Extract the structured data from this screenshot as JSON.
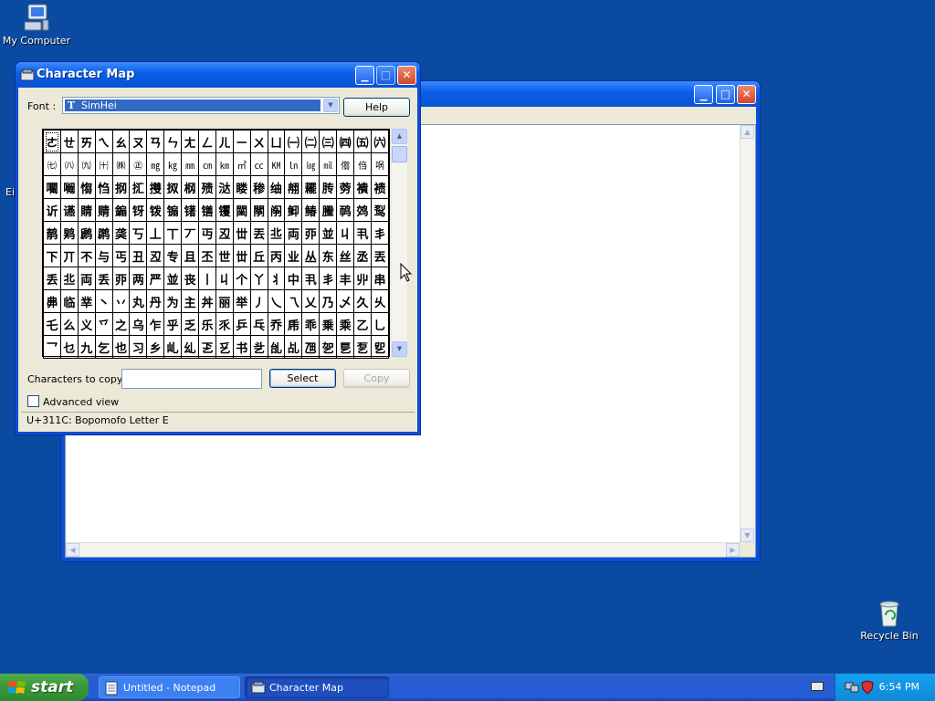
{
  "desktop": {
    "icons": [
      {
        "label": "My Computer"
      },
      {
        "label": "Recycle Bin"
      }
    ],
    "partial_label": "Ei"
  },
  "charmap": {
    "title": "Character Map",
    "font_label": "Font :",
    "font_value": "SimHei",
    "help_label": "Help",
    "copy_label": "Characters to copy :",
    "copy_value": "",
    "select_label": "Select",
    "copy_button_label": "Copy",
    "advanced_label": "Advanced view",
    "status": "U+311C: Bopomofo Letter E",
    "grid": [
      [
        "ㄜ",
        "ㄝ",
        "ㄞ",
        "ㄟ",
        "ㄠ",
        "ㄡ",
        "ㄢ",
        "ㄣ",
        "ㄤ",
        "ㄥ",
        "ㄦ",
        "ㄧ",
        "ㄨ",
        "ㄩ",
        "㈠",
        "㈡",
        "㈢",
        "㈣",
        "㈤",
        "㈥"
      ],
      [
        "㈦",
        "㈧",
        "㈨",
        "㈩",
        "㈱",
        "㊣",
        "㎎",
        "㎏",
        "㎜",
        "㎝",
        "㎞",
        "㎡",
        "㏄",
        "㏎",
        "㏑",
        "㏒",
        "㏕",
        "㑳",
        "㑇",
        "㖞"
      ],
      [
        "㘚",
        "㘎",
        "㥮",
        "㤘",
        "㧏",
        "㧟",
        "㩳",
        "㧐",
        "㭎",
        "㱮",
        "㳠",
        "䁖",
        "䅟",
        "䌷",
        "䎃",
        "䎱",
        "䏝",
        "䓖",
        "䙡",
        "䙌"
      ],
      [
        "䜣",
        "䜩",
        "䝼",
        "䞍",
        "䥇",
        "䥺",
        "䥽",
        "䦂",
        "䦃",
        "䦅",
        "䦆",
        "䦟",
        "䦛",
        "䦶",
        "䲟",
        "䲠",
        "䲢",
        "䴓",
        "䴔",
        "䴕"
      ],
      [
        "䴖",
        "䴗",
        "䴘",
        "䴙",
        "䶮",
        "丂",
        "丄",
        "丅",
        "丆",
        "丏",
        "丒",
        "丗",
        "丟",
        "丠",
        "両",
        "丣",
        "並",
        "丩",
        "丮",
        "丯"
      ],
      [
        "下",
        "丌",
        "不",
        "与",
        "丐",
        "丑",
        "丒",
        "专",
        "且",
        "丕",
        "世",
        "丗",
        "丘",
        "丙",
        "业",
        "丛",
        "东",
        "丝",
        "丞",
        "丟"
      ],
      [
        "丢",
        "丠",
        "両",
        "丢",
        "丣",
        "两",
        "严",
        "並",
        "丧",
        "丨",
        "丩",
        "个",
        "丫",
        "丬",
        "中",
        "丮",
        "丯",
        "丰",
        "丱",
        "串"
      ],
      [
        "丳",
        "临",
        "丵",
        "丶",
        "丷",
        "丸",
        "丹",
        "为",
        "主",
        "丼",
        "丽",
        "举",
        "丿",
        "乀",
        "乁",
        "乂",
        "乃",
        "乄",
        "久",
        "乆"
      ],
      [
        "乇",
        "么",
        "义",
        "乊",
        "之",
        "乌",
        "乍",
        "乎",
        "乏",
        "乐",
        "乑",
        "乒",
        "乓",
        "乔",
        "乕",
        "乖",
        "乗",
        "乘",
        "乙",
        "乚"
      ],
      [
        "乛",
        "乜",
        "九",
        "乞",
        "也",
        "习",
        "乡",
        "乢",
        "乣",
        "乤",
        "乥",
        "书",
        "乧",
        "乨",
        "乩",
        "乪",
        "乫",
        "乬",
        "乭",
        "乮"
      ]
    ]
  },
  "taskbar": {
    "start_label": "start",
    "tasks": [
      {
        "label": "Untitled - Notepad"
      },
      {
        "label": "Character Map"
      }
    ],
    "clock": "6:54 PM"
  },
  "colors": {
    "desktop": "#0a4aa0",
    "titlebar": "#0b5fe8",
    "dialog_face": "#ece9d8",
    "selection": "#316ac5"
  }
}
